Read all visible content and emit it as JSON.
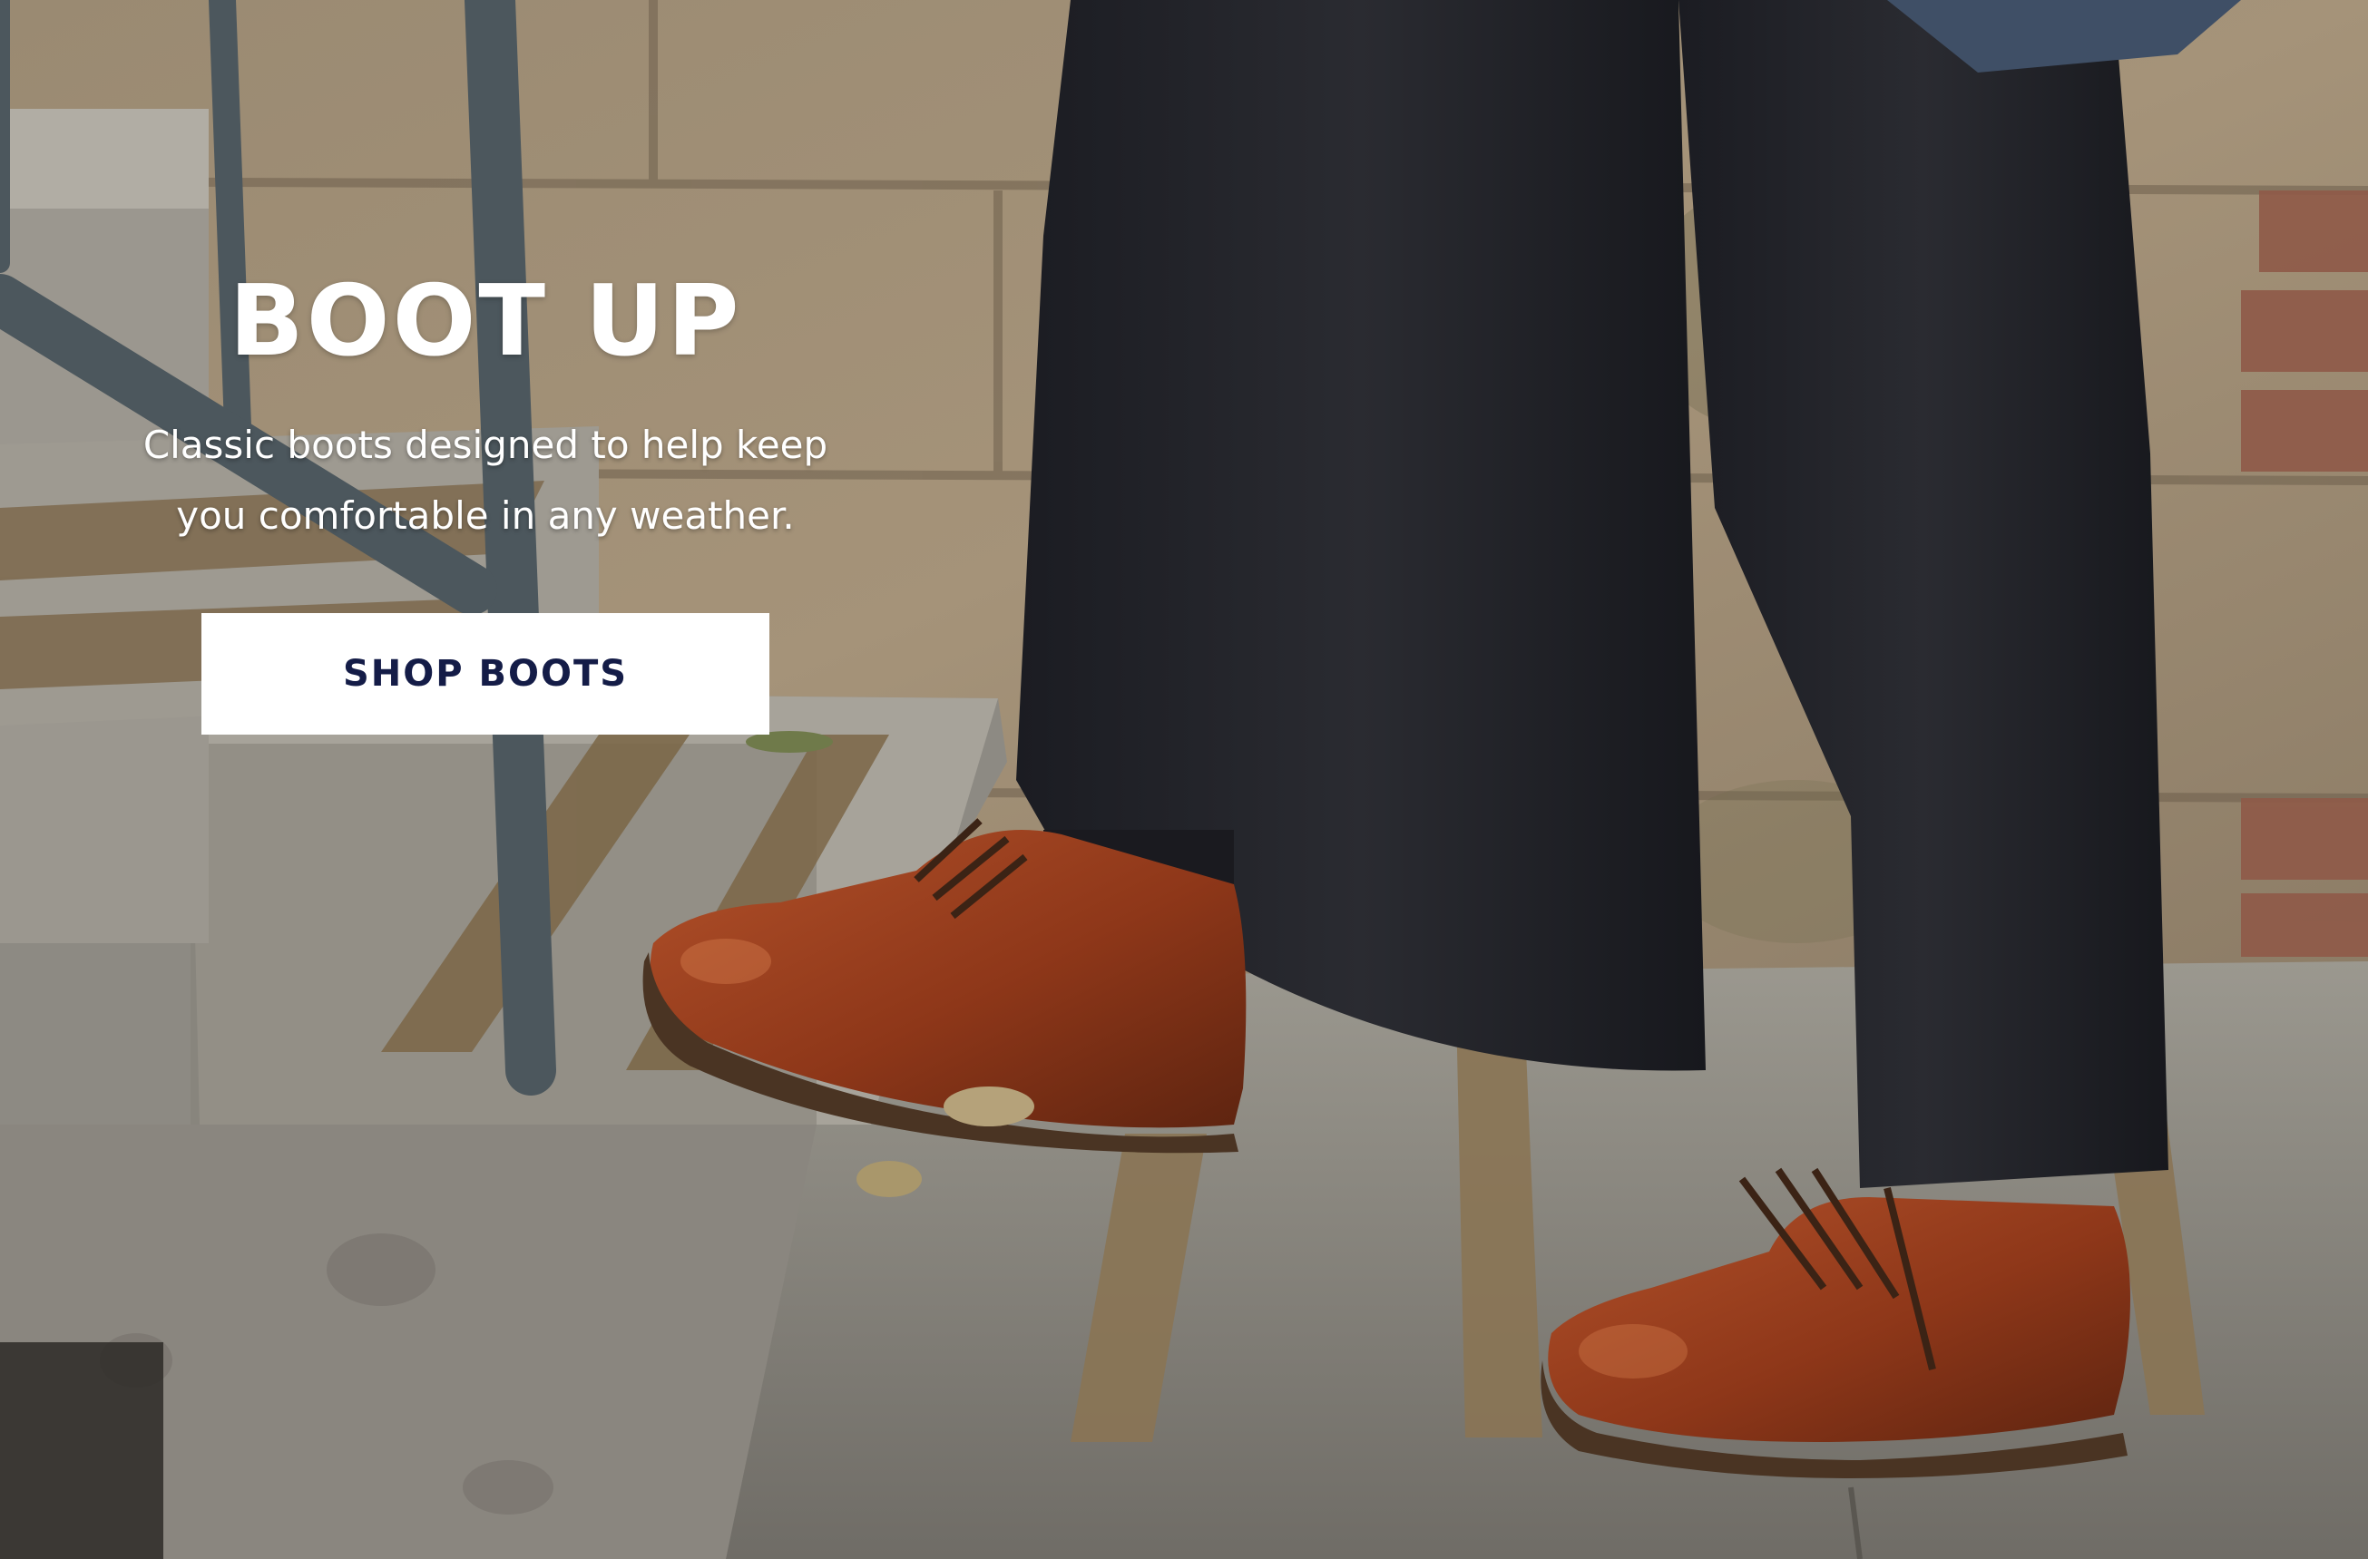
{
  "hero": {
    "title": "BOOT UP",
    "subtitle": "Classic boots designed to help keep you comfortable in any weather.",
    "cta_label": "SHOP BOOTS"
  },
  "colors": {
    "title_text": "#ffffff",
    "cta_background": "#ffffff",
    "cta_text": "#141c47"
  }
}
